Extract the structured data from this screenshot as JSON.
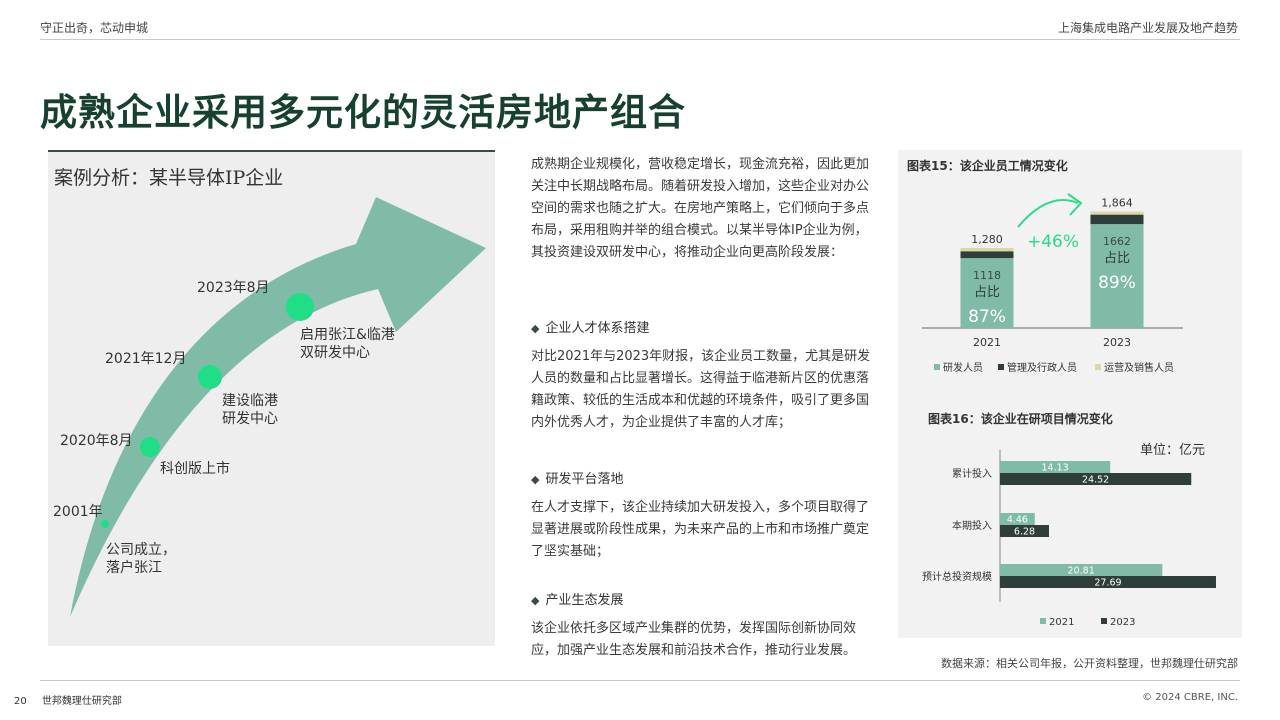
{
  "header": {
    "left": "守正出奇，芯动申城",
    "right": "上海集成电路产业发展及地产趋势"
  },
  "title": "成熟企业采用多元化的灵活房地产组合",
  "case": {
    "title": "案例分析：某半导体IP企业",
    "milestones": [
      {
        "date": "2001年",
        "desc_lines": [
          "公司成立，",
          "落户张江"
        ]
      },
      {
        "date": "2020年8月",
        "desc_lines": [
          "科创版上市"
        ]
      },
      {
        "date": "2021年12月",
        "desc_lines": [
          "建设临港",
          "研发中心"
        ]
      },
      {
        "date": "2023年8月",
        "desc_lines": [
          "启用张江&临港",
          "双研发中心"
        ]
      }
    ]
  },
  "body": {
    "intro": "成熟期企业规模化，营收稳定增长，现金流充裕，因此更加关注中长期战略布局。随着研发投入增加，这些企业对办公空间的需求也随之扩大。在房地产策略上，它们倾向于多点布局，采用租购并举的组合模式。以某半导体IP企业为例，其投资建设双研发中心，将推动企业向更高阶段发展：",
    "sections": [
      {
        "heading": "企业人才体系搭建",
        "text": "对比2021年与2023年财报，该企业员工数量，尤其是研发人员的数量和占比显著增长。这得益于临港新片区的优惠落籍政策、较低的生活成本和优越的环境条件，吸引了更多国内外优秀人才，为企业提供了丰富的人才库；"
      },
      {
        "heading": "研发平台落地",
        "text": "在人才支撑下，该企业持续加大研发投入，多个项目取得了显著进展或阶段性成果，为未来产品的上市和市场推广奠定了坚实基础；"
      },
      {
        "heading": "产业生态发展",
        "text": "该企业依托多区域产业集群的优势，发挥国际创新协同效应，加强产业生态发展和前沿技术合作，推动行业发展。"
      }
    ]
  },
  "chart_data": [
    {
      "type": "bar",
      "stacked": true,
      "title": "图表15：该企业员工情况变化",
      "categories": [
        "2021",
        "2023"
      ],
      "totals": [
        1280,
        1864
      ],
      "series": [
        {
          "name": "研发人员",
          "values": [
            1118,
            1662
          ],
          "color": "#80bba8"
        },
        {
          "name": "管理及行政人员",
          "values": [
            110,
            152
          ],
          "color": "#2f3e3a"
        },
        {
          "name": "运营及销售人员",
          "values": [
            52,
            50
          ],
          "color": "#dcd8a3"
        }
      ],
      "share_label": "占比",
      "shares": [
        "87%",
        "89%"
      ],
      "growth_label": "+46%",
      "legend": "bottom"
    },
    {
      "type": "bar",
      "orientation": "horizontal",
      "title": "图表16：该企业在研项目情况变化",
      "unit": "单位：亿元",
      "categories": [
        "累计投入",
        "本期投入",
        "预计总投资规模"
      ],
      "series": [
        {
          "name": "2021",
          "values": [
            14.13,
            4.46,
            20.81
          ],
          "color": "#80bba8"
        },
        {
          "name": "2023",
          "values": [
            24.52,
            6.28,
            27.69
          ],
          "color": "#2f3e3a"
        }
      ],
      "legend": "bottom"
    }
  ],
  "source": "数据来源：相关公司年报，公开资料整理，世邦魏理仕研究部",
  "footer": {
    "page": "20",
    "dept": "世邦魏理仕研究部",
    "copyright": "© 2024 CBRE, INC."
  },
  "colors": {
    "title": "#17412f",
    "accent": "#80bba8",
    "dot": "#1fde86",
    "dark": "#2f3e3a"
  }
}
